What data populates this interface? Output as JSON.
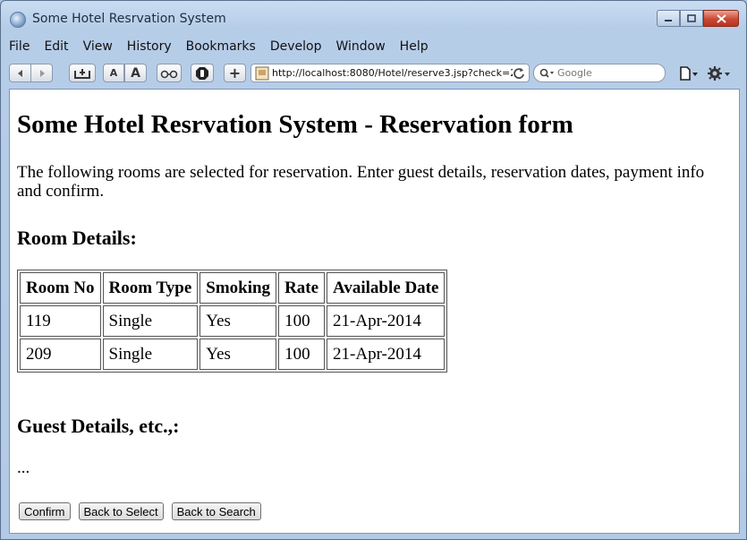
{
  "window": {
    "title": "Some Hotel Resrvation System"
  },
  "menu": [
    "File",
    "Edit",
    "View",
    "History",
    "Bookmarks",
    "Develop",
    "Window",
    "Help"
  ],
  "toolbar": {
    "text_smaller": "A",
    "text_larger": "A",
    "add_tab": "+",
    "address": "http://localhost:8080/Hotel/reserve3.jsp?check=2&",
    "search_placeholder": "Google"
  },
  "page": {
    "heading": "Some Hotel Resrvation System - Reservation form",
    "intro": "The following rooms are selected for reservation. Enter guest details, reservation dates, payment info and confirm.",
    "room_details_heading": "Room Details:",
    "table": {
      "headers": [
        "Room No",
        "Room Type",
        "Smoking",
        "Rate",
        "Available Date"
      ],
      "rows": [
        [
          "119",
          "Single",
          "Yes",
          "100",
          "21-Apr-2014"
        ],
        [
          "209",
          "Single",
          "Yes",
          "100",
          "21-Apr-2014"
        ]
      ]
    },
    "guest_heading": "Guest Details, etc.,:",
    "ellipsis": "...",
    "buttons": {
      "confirm": "Confirm",
      "back_select": "Back to Select",
      "back_search": "Back to Search"
    }
  }
}
